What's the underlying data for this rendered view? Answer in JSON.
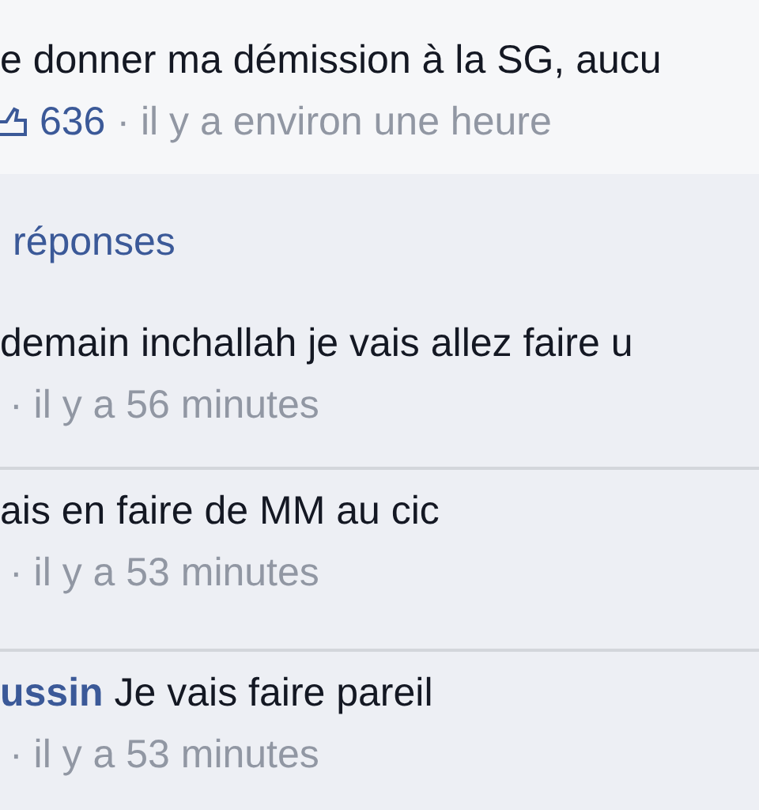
{
  "comment": {
    "text": "e donner ma démission à la SG, aucu",
    "likes": "636",
    "time": "· il y a environ une heure"
  },
  "replies_link": "réponses",
  "replies": [
    {
      "text": "demain inchallah je vais allez faire u",
      "time": "· il y a 56 minutes"
    },
    {
      "text": "ais en faire de MM au cic",
      "time": "· il y a 53 minutes"
    },
    {
      "author": "ussin",
      "text": "Je vais faire pareil",
      "time": "· il y a 53 minutes"
    }
  ]
}
